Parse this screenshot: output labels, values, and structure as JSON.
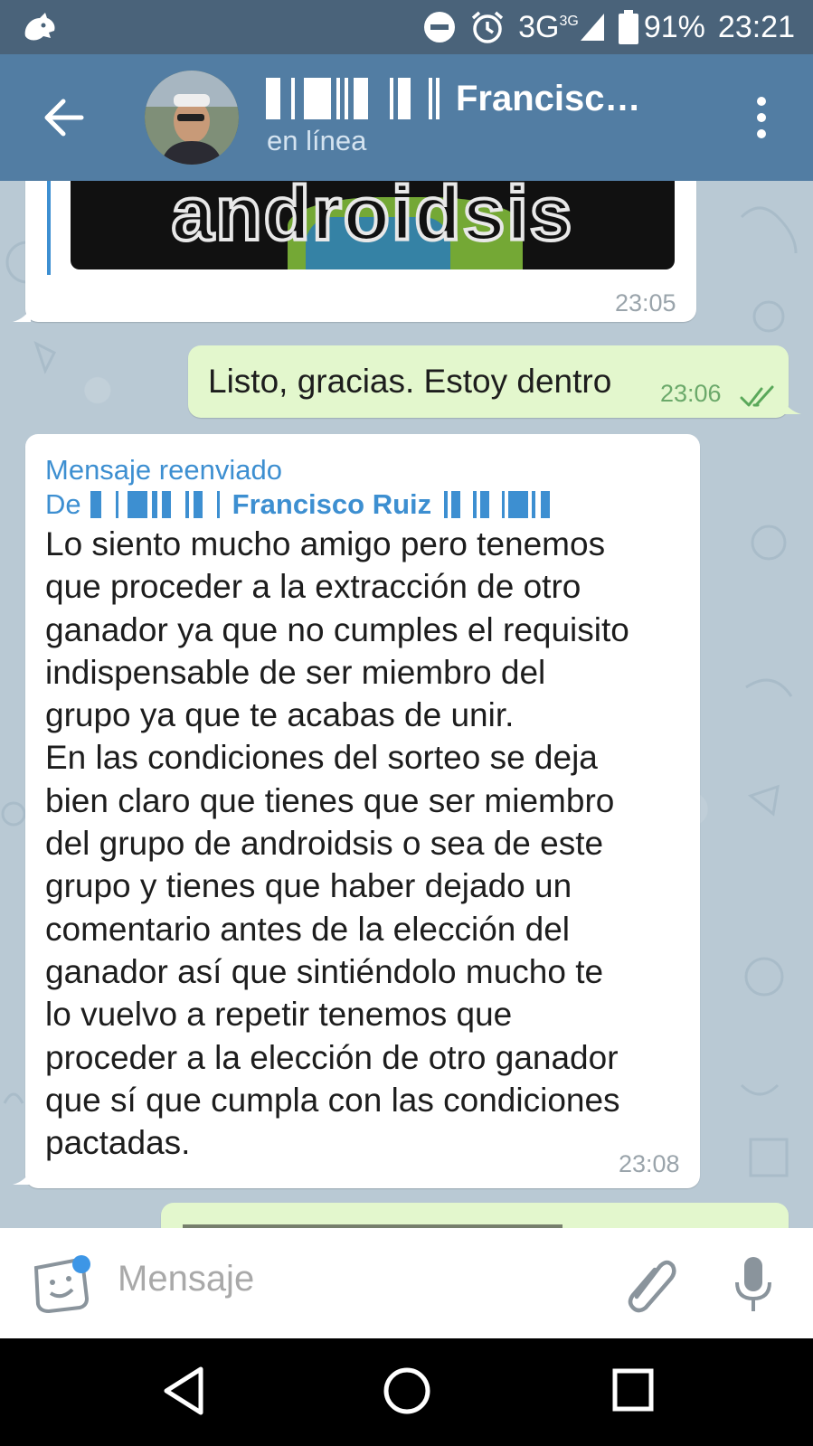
{
  "status_bar": {
    "network": "3G",
    "network_sup": "3G",
    "battery": "91%",
    "time": "23:21"
  },
  "header": {
    "title_visible": "Francisc…",
    "status": "en línea",
    "icons": [
      "back-arrow-icon",
      "avatar",
      "more-vertical-icon"
    ]
  },
  "messages": {
    "image_msg": {
      "image_text": "androidsis",
      "time": "23:05"
    },
    "reply": {
      "text": "Listo, gracias. Estoy dentro",
      "time": "23:06"
    },
    "forwarded": {
      "label": "Mensaje reenviado",
      "from_prefix": "De",
      "from_name": "Francisco Ruiz",
      "text": "Lo siento mucho amigo pero tenemos\nque proceder a la extracción de otro\nganador ya que no cumples el requisito\nindispensable de ser miembro del\ngrupo ya que te acabas de unir.\nEn las condiciones del sorteo se deja\nbien claro que tienes que ser miembro\ndel grupo de androidsis o sea de este\ngrupo y tienes que haber dejado un\ncomentario antes de la elección del\nganador así que sintiéndolo mucho te\nlo vuelvo a repetir tenemos que\nproceder a la elección de otro ganador\nque sí que cumpla con las condiciones\npactadas.",
      "time": "23:08"
    }
  },
  "composer": {
    "placeholder": "Mensaje"
  },
  "colors": {
    "status_bar": "#4a637a",
    "app_bar": "#527da3",
    "outgoing_bubble": "#e3f7cd",
    "forward_accent": "#3d8fd1"
  }
}
